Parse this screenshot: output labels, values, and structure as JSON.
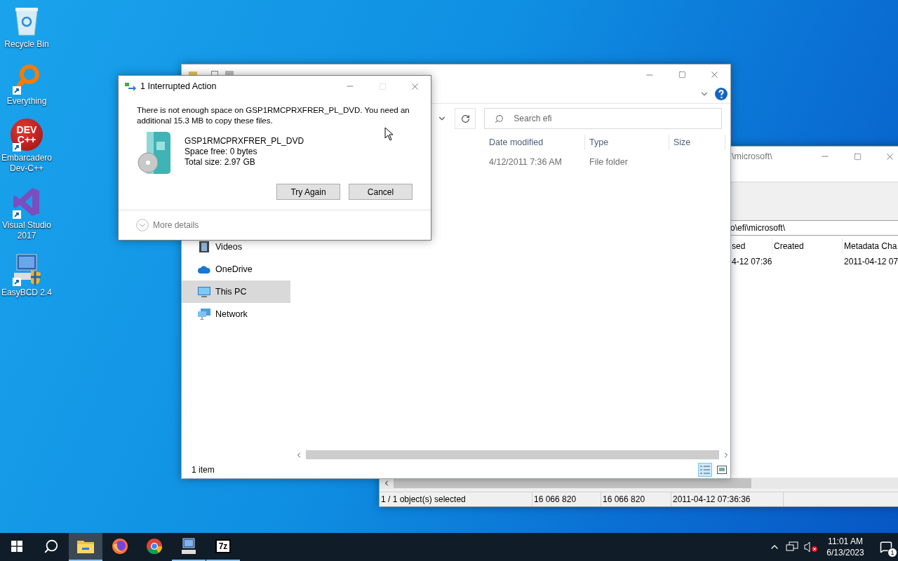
{
  "desktop_icons": [
    {
      "kind": "recycle_bin",
      "label": "Recycle Bin",
      "shortcut": false
    },
    {
      "kind": "everything",
      "label": "Everything",
      "shortcut": true
    },
    {
      "kind": "devcpp",
      "label": "Embarcadero Dev-C++",
      "logo_lines": [
        "DEV",
        "C++"
      ],
      "shortcut": true
    },
    {
      "kind": "visual_studio",
      "label": "Visual Studio 2017",
      "shortcut": true
    },
    {
      "kind": "easybcd",
      "label": "EasyBCD 2.4",
      "shortcut": true
    }
  ],
  "file_manager_window": {
    "title": "\\microsoft\\",
    "address": "o\\efi\\microsoft\\",
    "columns": [
      "sed",
      "Created",
      "Metadata Cha"
    ],
    "rows": [
      {
        "cells": [
          "4-12 07:36",
          null,
          "2011-04-12 07"
        ]
      }
    ],
    "status_bar": [
      "1 / 1 object(s) selected",
      "16 066 820",
      "16 066 820",
      "2011-04-12 07:36:36"
    ]
  },
  "explorer": {
    "search_placeholder": "Search efi",
    "columns": [
      "Date modified",
      "Type",
      "Size"
    ],
    "rows": [
      {
        "date_modified": "4/12/2011 7:36 AM",
        "type": "File folder"
      }
    ],
    "nav_items": [
      {
        "kind": "videos",
        "label": "Videos",
        "selected": false
      },
      {
        "kind": "onedrive",
        "label": "OneDrive",
        "selected": false
      },
      {
        "kind": "this_pc",
        "label": "This PC",
        "selected": true
      },
      {
        "kind": "network",
        "label": "Network",
        "selected": false
      }
    ],
    "status": "1 item",
    "views": [
      {
        "kind": "details",
        "selected": true
      },
      {
        "kind": "large_icons",
        "selected": false
      }
    ]
  },
  "dialog": {
    "title": "1 Interrupted Action",
    "maximize_disabled": true,
    "message": "There is not enough space on GSP1RMCPRXFRER_PL_DVD. You need an additional 15.3 MB to copy these files.",
    "drive": {
      "name": "GSP1RMCPRXFRER_PL_DVD",
      "details": [
        "Space free: 0 bytes",
        "Total size: 2.97 GB"
      ]
    },
    "buttons": [
      "Try Again",
      "Cancel"
    ],
    "more_details": "More details"
  },
  "taskbar": {
    "items": [
      {
        "kind": "start",
        "selected": false,
        "running": false
      },
      {
        "kind": "search",
        "selected": false,
        "running": false
      },
      {
        "kind": "file_explorer",
        "selected": true,
        "running": true
      },
      {
        "kind": "firefox",
        "selected": false,
        "running": false
      },
      {
        "kind": "chrome",
        "selected": false,
        "running": false
      },
      {
        "kind": "computer_app",
        "selected": false,
        "running": true
      },
      {
        "kind": "sevenzip",
        "label": "7z",
        "selected": false,
        "running": true
      }
    ],
    "tray": {
      "time": "11:01 AM",
      "date": "6/13/2023",
      "notification_count": "1",
      "volume_muted": true
    }
  }
}
